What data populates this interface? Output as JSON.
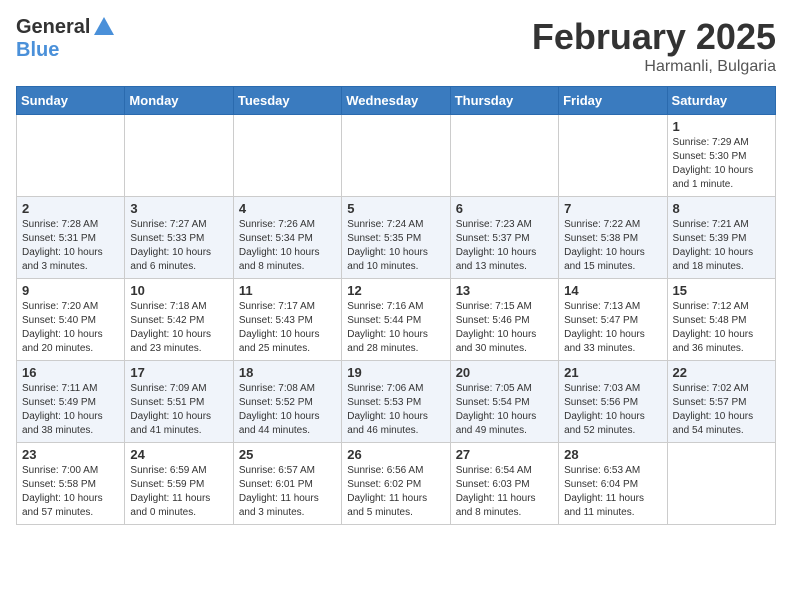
{
  "header": {
    "logo_general": "General",
    "logo_blue": "Blue",
    "month_title": "February 2025",
    "location": "Harmanli, Bulgaria"
  },
  "weekdays": [
    "Sunday",
    "Monday",
    "Tuesday",
    "Wednesday",
    "Thursday",
    "Friday",
    "Saturday"
  ],
  "weeks": [
    [
      {
        "day": "",
        "info": ""
      },
      {
        "day": "",
        "info": ""
      },
      {
        "day": "",
        "info": ""
      },
      {
        "day": "",
        "info": ""
      },
      {
        "day": "",
        "info": ""
      },
      {
        "day": "",
        "info": ""
      },
      {
        "day": "1",
        "info": "Sunrise: 7:29 AM\nSunset: 5:30 PM\nDaylight: 10 hours\nand 1 minute."
      }
    ],
    [
      {
        "day": "2",
        "info": "Sunrise: 7:28 AM\nSunset: 5:31 PM\nDaylight: 10 hours\nand 3 minutes."
      },
      {
        "day": "3",
        "info": "Sunrise: 7:27 AM\nSunset: 5:33 PM\nDaylight: 10 hours\nand 6 minutes."
      },
      {
        "day": "4",
        "info": "Sunrise: 7:26 AM\nSunset: 5:34 PM\nDaylight: 10 hours\nand 8 minutes."
      },
      {
        "day": "5",
        "info": "Sunrise: 7:24 AM\nSunset: 5:35 PM\nDaylight: 10 hours\nand 10 minutes."
      },
      {
        "day": "6",
        "info": "Sunrise: 7:23 AM\nSunset: 5:37 PM\nDaylight: 10 hours\nand 13 minutes."
      },
      {
        "day": "7",
        "info": "Sunrise: 7:22 AM\nSunset: 5:38 PM\nDaylight: 10 hours\nand 15 minutes."
      },
      {
        "day": "8",
        "info": "Sunrise: 7:21 AM\nSunset: 5:39 PM\nDaylight: 10 hours\nand 18 minutes."
      }
    ],
    [
      {
        "day": "9",
        "info": "Sunrise: 7:20 AM\nSunset: 5:40 PM\nDaylight: 10 hours\nand 20 minutes."
      },
      {
        "day": "10",
        "info": "Sunrise: 7:18 AM\nSunset: 5:42 PM\nDaylight: 10 hours\nand 23 minutes."
      },
      {
        "day": "11",
        "info": "Sunrise: 7:17 AM\nSunset: 5:43 PM\nDaylight: 10 hours\nand 25 minutes."
      },
      {
        "day": "12",
        "info": "Sunrise: 7:16 AM\nSunset: 5:44 PM\nDaylight: 10 hours\nand 28 minutes."
      },
      {
        "day": "13",
        "info": "Sunrise: 7:15 AM\nSunset: 5:46 PM\nDaylight: 10 hours\nand 30 minutes."
      },
      {
        "day": "14",
        "info": "Sunrise: 7:13 AM\nSunset: 5:47 PM\nDaylight: 10 hours\nand 33 minutes."
      },
      {
        "day": "15",
        "info": "Sunrise: 7:12 AM\nSunset: 5:48 PM\nDaylight: 10 hours\nand 36 minutes."
      }
    ],
    [
      {
        "day": "16",
        "info": "Sunrise: 7:11 AM\nSunset: 5:49 PM\nDaylight: 10 hours\nand 38 minutes."
      },
      {
        "day": "17",
        "info": "Sunrise: 7:09 AM\nSunset: 5:51 PM\nDaylight: 10 hours\nand 41 minutes."
      },
      {
        "day": "18",
        "info": "Sunrise: 7:08 AM\nSunset: 5:52 PM\nDaylight: 10 hours\nand 44 minutes."
      },
      {
        "day": "19",
        "info": "Sunrise: 7:06 AM\nSunset: 5:53 PM\nDaylight: 10 hours\nand 46 minutes."
      },
      {
        "day": "20",
        "info": "Sunrise: 7:05 AM\nSunset: 5:54 PM\nDaylight: 10 hours\nand 49 minutes."
      },
      {
        "day": "21",
        "info": "Sunrise: 7:03 AM\nSunset: 5:56 PM\nDaylight: 10 hours\nand 52 minutes."
      },
      {
        "day": "22",
        "info": "Sunrise: 7:02 AM\nSunset: 5:57 PM\nDaylight: 10 hours\nand 54 minutes."
      }
    ],
    [
      {
        "day": "23",
        "info": "Sunrise: 7:00 AM\nSunset: 5:58 PM\nDaylight: 10 hours\nand 57 minutes."
      },
      {
        "day": "24",
        "info": "Sunrise: 6:59 AM\nSunset: 5:59 PM\nDaylight: 11 hours\nand 0 minutes."
      },
      {
        "day": "25",
        "info": "Sunrise: 6:57 AM\nSunset: 6:01 PM\nDaylight: 11 hours\nand 3 minutes."
      },
      {
        "day": "26",
        "info": "Sunrise: 6:56 AM\nSunset: 6:02 PM\nDaylight: 11 hours\nand 5 minutes."
      },
      {
        "day": "27",
        "info": "Sunrise: 6:54 AM\nSunset: 6:03 PM\nDaylight: 11 hours\nand 8 minutes."
      },
      {
        "day": "28",
        "info": "Sunrise: 6:53 AM\nSunset: 6:04 PM\nDaylight: 11 hours\nand 11 minutes."
      },
      {
        "day": "",
        "info": ""
      }
    ]
  ]
}
